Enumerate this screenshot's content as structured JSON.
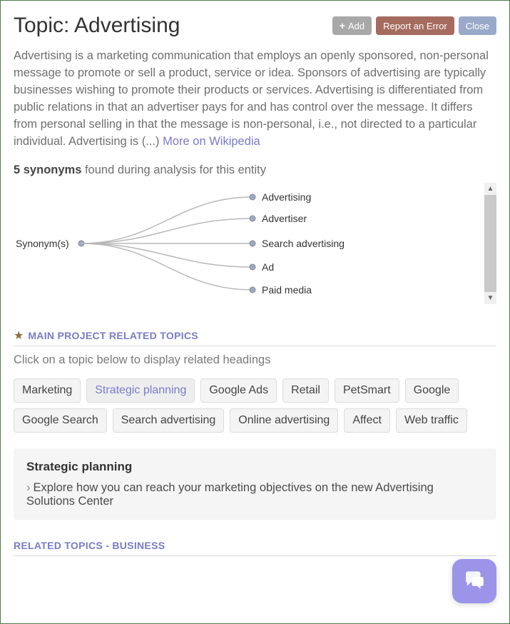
{
  "header": {
    "title": "Topic: Advertising",
    "add_label": "Add",
    "report_label": "Report an Error",
    "close_label": "Close"
  },
  "description": {
    "text": "Advertising is a marketing communication that employs an openly sponsored, non-personal message to promote or sell a product, service or idea. Sponsors of advertising are typically businesses wishing to promote their products or services. Advertising is differentiated from public relations in that an advertiser pays for and has control over the message. It differs from personal selling in that the message is non-personal, i.e., not directed to a particular individual. Advertising is (...) ",
    "link_label": "More on Wikipedia"
  },
  "synonyms": {
    "count_label": "5 synonyms",
    "tail_label": " found during analysis for this entity",
    "root_label": "Synonym(s)",
    "items": [
      "Advertising",
      "Advertiser",
      "Search advertising",
      "Ad",
      "Paid media"
    ]
  },
  "main_topics": {
    "section_title": "MAIN PROJECT RELATED TOPICS",
    "hint": "Click on a topic below to display related headings",
    "chips": [
      "Marketing",
      "Strategic planning",
      "Google Ads",
      "Retail",
      "PetSmart",
      "Google",
      "Google Search",
      "Search advertising",
      "Online advertising",
      "Affect",
      "Web traffic"
    ],
    "selected_index": 1
  },
  "detail": {
    "title": "Strategic planning",
    "text": "Explore how you can reach your marketing objectives on the new Advertising Solutions Center"
  },
  "related": {
    "section_title": "RELATED TOPICS - BUSINESS"
  }
}
